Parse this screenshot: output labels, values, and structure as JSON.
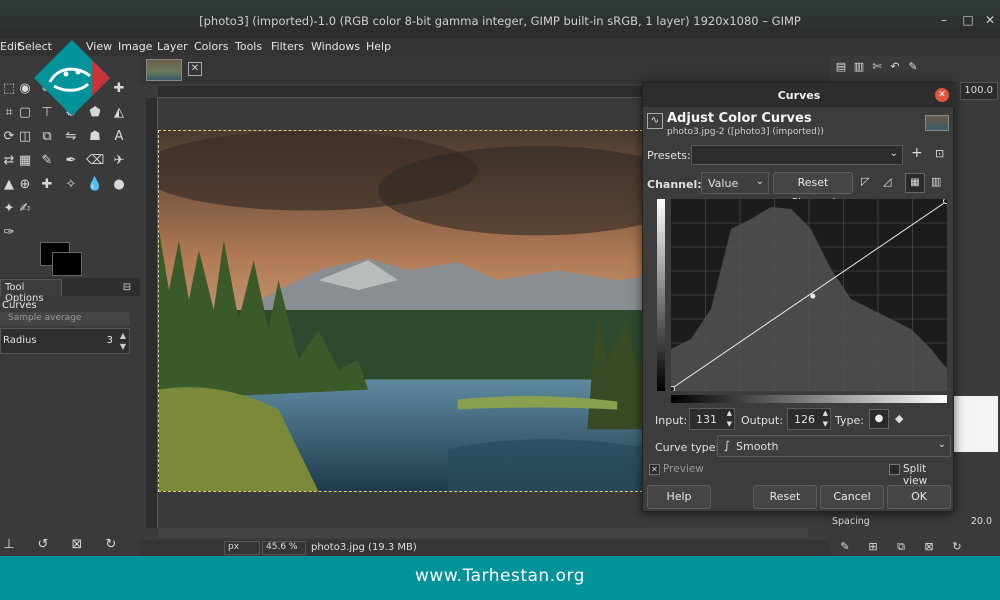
{
  "window": {
    "title": "[photo3] (imported)-1.0 (RGB color 8-bit gamma integer, GIMP built-in sRGB, 1 layer) 1920x1080 – GIMP"
  },
  "menu": [
    "Edit",
    "Select",
    "View",
    "Image",
    "Layer",
    "Colors",
    "Tools",
    "Filters",
    "Windows",
    "Help"
  ],
  "toolbox": {
    "tab_label": "Tool Options",
    "tool_name": "Curves",
    "sample_average": "Sample average",
    "radius_label": "Radius",
    "radius_value": "3"
  },
  "status": {
    "unit": "px",
    "zoom": "45.6 %",
    "file": "photo3.jpg (19.3 MB)"
  },
  "dock": {
    "value": "100.0",
    "spacing_label": "Spacing",
    "spacing_value": "20.0"
  },
  "dialog": {
    "title": "Curves",
    "heading": "Adjust Color Curves",
    "subtitle": "photo3.jpg-2 ([photo3] (imported))",
    "presets_label": "Presets:",
    "channel_label": "Channel:",
    "channel_value": "Value",
    "reset_channel": "Reset Channel",
    "input_label": "Input:",
    "input_value": "131",
    "output_label": "Output:",
    "output_value": "126",
    "type_label": "Type:",
    "curve_type_label": "Curve type:",
    "curve_type_value": "Smooth",
    "preview_label": "Preview",
    "split_view_label": "Split view",
    "help": "Help",
    "reset": "Reset",
    "cancel": "Cancel",
    "ok": "OK",
    "curve_point": {
      "input": 131,
      "output": 126
    }
  },
  "footer": {
    "url": "www.Tarhestan.org"
  },
  "colors": {
    "accent_close": "#e0553b",
    "footer_bg": "#00939a",
    "logo_bg": "#00939a",
    "logo_accent": "#c8343a"
  }
}
